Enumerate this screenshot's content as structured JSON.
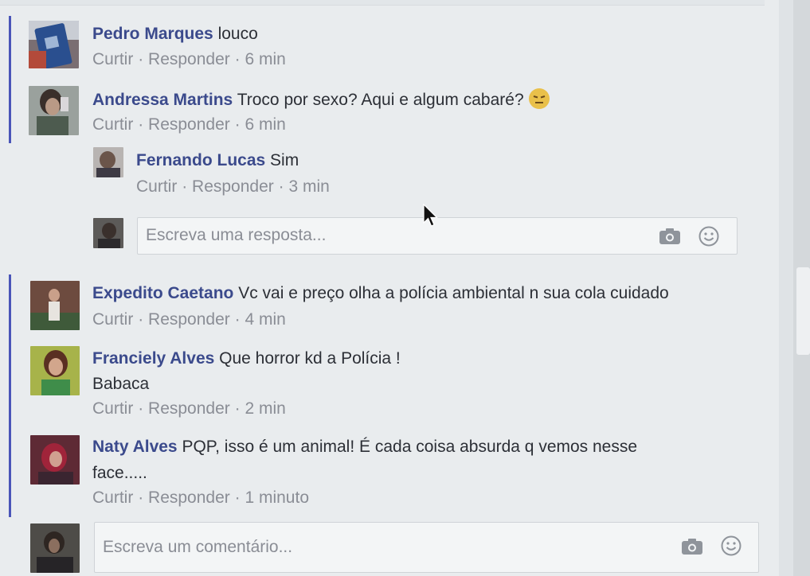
{
  "comments": [
    {
      "author": "Pedro Marques",
      "text": "louco",
      "like": "Curtir",
      "reply": "Responder",
      "time": "6 min"
    },
    {
      "author": "Andressa Martins",
      "text": "Troco por sexo? Aqui e algum cabaré?",
      "emoji": "annoyed-emoji",
      "like": "Curtir",
      "reply": "Responder",
      "time": "6 min"
    },
    {
      "author": "Fernando Lucas",
      "text": "Sim",
      "like": "Curtir",
      "reply": "Responder",
      "time": "3 min"
    },
    {
      "author": "Expedito Caetano",
      "text": "Vc vai e preço olha a polícia ambiental n sua cola cuidado",
      "like": "Curtir",
      "reply": "Responder",
      "time": "4 min"
    },
    {
      "author": "Franciely Alves",
      "text": "Que horror kd a Polícia !",
      "text2": "Babaca",
      "like": "Curtir",
      "reply": "Responder",
      "time": "2 min"
    },
    {
      "author": "Naty Alves",
      "text": "PQP, isso é um animal! É cada coisa absurda q vemos nesse",
      "text2": "face.....",
      "like": "Curtir",
      "reply": "Responder",
      "time": "1 minuto"
    }
  ],
  "reply_box": {
    "placeholder": "Escreva uma resposta..."
  },
  "comment_box": {
    "placeholder": "Escreva um comentário..."
  },
  "separator": "·",
  "icons": [
    "camera-icon",
    "smiley-icon",
    "mouse-cursor-icon"
  ],
  "colors": {
    "author": "#3b4a8c",
    "meta": "#8a8d95",
    "thread_bar": "#4a55b8",
    "text": "#2c2f36"
  }
}
